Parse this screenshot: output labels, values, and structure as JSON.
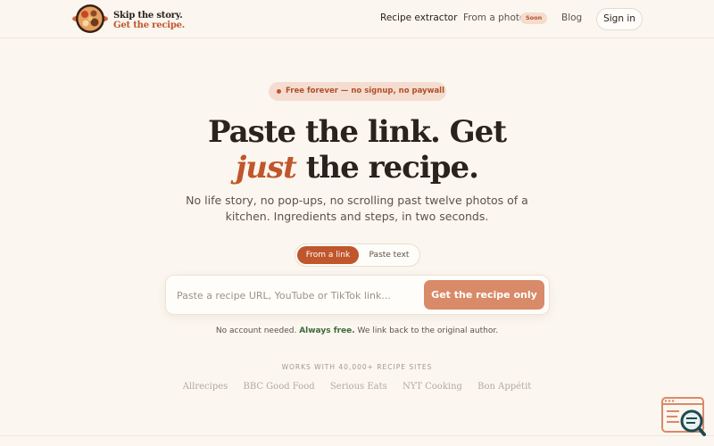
{
  "brand": {
    "line1": "Skip the story.",
    "line2": "Get the recipe."
  },
  "nav": {
    "recipe_extractor": "Recipe extractor",
    "from_photo": "From a photo",
    "soon": "Soon",
    "blog": "Blog",
    "sign_in": "Sign in"
  },
  "hero": {
    "pill": "Free forever — no signup, no paywall",
    "headline_line1": "Paste the link. Get",
    "headline_accent": "just",
    "headline_rest": " the recipe.",
    "sub_line1": "No life story, no pop-ups, no scrolling past twelve photos of a",
    "sub_line2": "kitchen. Ingredients and steps, in two seconds."
  },
  "toggle": {
    "active": "From a link",
    "inactive": "Paste text"
  },
  "search": {
    "placeholder": "Paste a recipe URL, YouTube or TikTok link...",
    "value": "",
    "button": "Get the recipe only"
  },
  "note": {
    "prefix": "No account needed. ",
    "strong": "Always free.",
    "suffix": " We link back to the original author."
  },
  "works_with": "WORKS WITH 40,000+ RECIPE SITES",
  "sites": [
    "Allrecipes",
    "BBC Good Food",
    "Serious Eats",
    "NYT Cooking",
    "Bon Appétit"
  ],
  "colors": {
    "accent": "#c0562c",
    "button": "#d98a68",
    "background": "#fbf6ef",
    "free": "#3d6a3d"
  },
  "icons": {
    "logo": "bowl-logo-icon",
    "pill_dot": "dot-icon",
    "widget": "document-search-icon"
  }
}
